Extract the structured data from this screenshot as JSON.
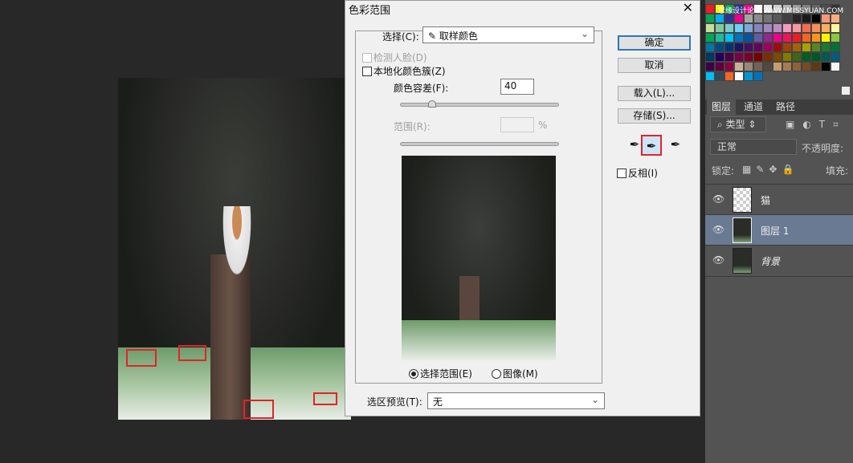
{
  "dialog": {
    "title": "色彩范围",
    "select_label": "选择(C):",
    "select_value": "取样颜色",
    "detect_faces": "检测人脸(D)",
    "localized_clusters": "本地化颜色簇(Z)",
    "fuzziness_label": "颜色容差(F):",
    "fuzziness_value": "40",
    "fuzziness_fraction": 0.2,
    "range_label": "范围(R):",
    "range_unit": "%",
    "radio_selection": "选择范围(E)",
    "radio_image": "图像(M)",
    "preview_label": "选区预览(T):",
    "preview_value": "无",
    "ok": "确定",
    "cancel": "取消",
    "load": "载入(L)...",
    "save": "存储(S)...",
    "invert": "反相(I)"
  },
  "panel": {
    "watermark": "思缘设计论坛 WWW.MISSYUAN.COM",
    "tabs": [
      "图层",
      "通道",
      "路径"
    ],
    "filter_kind": "类型",
    "blend_mode": "正常",
    "opacity_label": "不透明度:",
    "lock_label": "锁定:",
    "fill_label": "填充:",
    "layers": [
      {
        "name": "猫"
      },
      {
        "name": "图层 1"
      },
      {
        "name": "背景"
      }
    ]
  },
  "swatch_colors": [
    "#ee1c24",
    "#fff200",
    "#00a651",
    "#2e3192",
    "#ec008c",
    "#ffffff",
    "#e6e6e6",
    "#cccccc",
    "#b3b3b3",
    "#999999",
    "#808080",
    "#666666",
    "#4d4d4d",
    "#333333",
    "#00a651",
    "#00aeef",
    "#2e3192",
    "#ec008c",
    "#a6a6a6",
    "#8c8c8c",
    "#737373",
    "#595959",
    "#404040",
    "#262626",
    "#1a1a1a",
    "#000000",
    "#f7977a",
    "#f9ad81",
    "#c4df9b",
    "#82ca9c",
    "#7accc8",
    "#6dcff6",
    "#7da7d9",
    "#8781bd",
    "#a187be",
    "#bc8dbf",
    "#f49ac1",
    "#f6989d",
    "#f26c4f",
    "#f68e56",
    "#fbaf5d",
    "#fff79a",
    "#00a651",
    "#1abc9c",
    "#00bff3",
    "#0072bc",
    "#0054a6",
    "#605ca8",
    "#92278f",
    "#ec008c",
    "#ed145b",
    "#ed1c24",
    "#f26522",
    "#f7941d",
    "#fff200",
    "#8dc63f",
    "#0076a3",
    "#004a80",
    "#003471",
    "#1b1464",
    "#440e62",
    "#630460",
    "#9e005d",
    "#9e0b0f",
    "#a0410d",
    "#a36209",
    "#aba000",
    "#598527",
    "#1a7b30",
    "#007236",
    "#003663",
    "#21005d",
    "#4b0049",
    "#7b0046",
    "#7a0026",
    "#790000",
    "#7b2e00",
    "#7d4900",
    "#827b00",
    "#406618",
    "#005e20",
    "#005826",
    "#005952",
    "#005b7f",
    "#3b0048",
    "#5c0040",
    "#8a0040",
    "#c7b299",
    "#998675",
    "#736357",
    "#534741",
    "#c69c6d",
    "#a67c52",
    "#8c6239",
    "#754c24",
    "#603913",
    "#000000",
    "#f5f5f5",
    "#00bff3",
    "#2e4a5a",
    "#f26522",
    "#ffffff",
    "#0096d6",
    "#0072bc"
  ]
}
